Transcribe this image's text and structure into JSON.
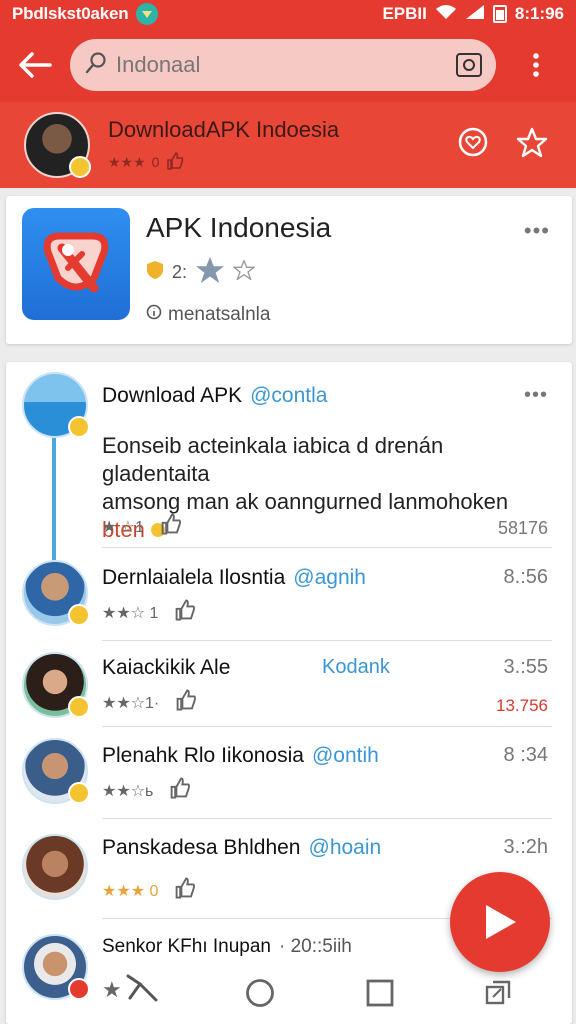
{
  "status": {
    "carrier": "Pbdlskst0aken",
    "indicators": "EPBII",
    "time": "8:1:96"
  },
  "search": {
    "value": "Indonaal"
  },
  "header": {
    "title": "DownloadAPK Indoesia",
    "rating_stars": "★★★",
    "rating_num": "0"
  },
  "app": {
    "name": "APK Indonesia",
    "rating_num": "2:",
    "subtitle": "menatsalnla",
    "more": "•••"
  },
  "feed": {
    "first": {
      "author": "Download APK",
      "handle": "@contla",
      "body_line1": "Eonseib acteinkala iabica d drenán gladentaita",
      "body_line2": "amsong man ak oanngurned lanmohoken",
      "tag": "bten",
      "stars": "★ ☆1",
      "count": "58176",
      "more": "•••"
    },
    "posts": [
      {
        "author": "Dernlaialela Ilosntia",
        "handle": "@agnih",
        "time": "8.:56",
        "stars": "★★☆ 1",
        "accent": ""
      },
      {
        "author": "Kaiackikik Ale",
        "handle": "Kodank",
        "time": "3.:55",
        "stars": "★★☆1·",
        "accent": "13.756"
      },
      {
        "author": "Plenahk Rlo Iikonosia",
        "handle": "@ontih",
        "time": "8 :34",
        "stars": "★★☆ь",
        "accent": ""
      },
      {
        "author": "Panskadesa Bhldhen",
        "handle": "@hoain",
        "time": "3.:2h",
        "stars": "★★★ 0",
        "accent": ""
      },
      {
        "author": "Senkor KFhı Inupan",
        "handle": "· 20::5iih",
        "time": "",
        "stars": "★",
        "accent": ""
      }
    ]
  },
  "colors": {
    "primary": "#e53a30",
    "link": "#3b97d3",
    "star_gold": "#e8a33b"
  }
}
